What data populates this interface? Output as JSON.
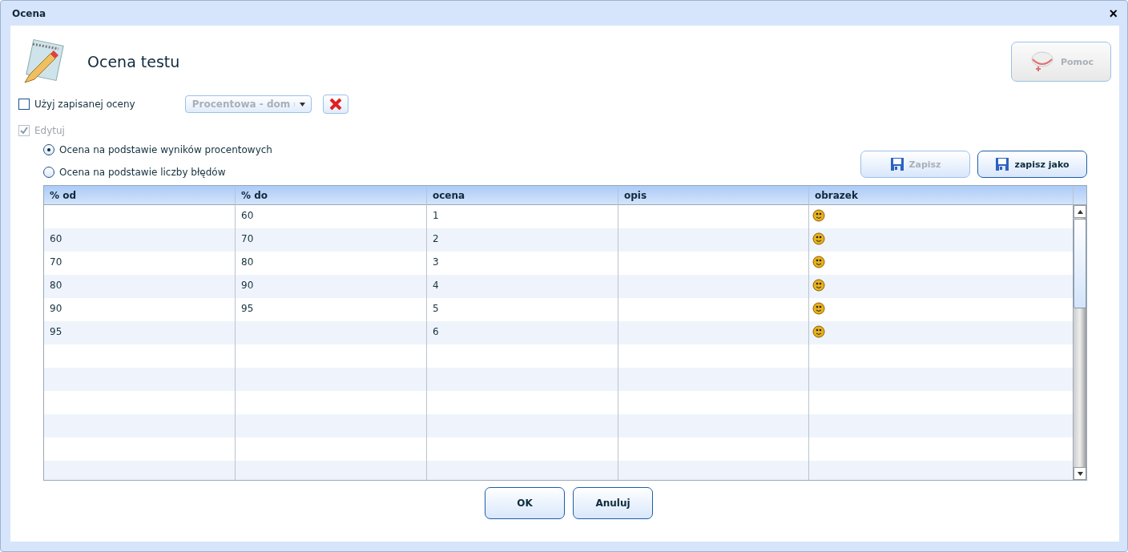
{
  "window": {
    "title": "Ocena",
    "close": "×"
  },
  "header": {
    "title": "Ocena testu",
    "help_button": {
      "label": "Pomoc",
      "disabled": true
    }
  },
  "use_saved": {
    "label": "Użyj zapisanej oceny",
    "checked": false
  },
  "saved_select": {
    "value": "Procentowa - dom",
    "disabled": true
  },
  "edit": {
    "label": "Edytuj",
    "checked": true,
    "disabled": true
  },
  "modes": [
    {
      "label": "Ocena na podstawie wyników procentowych",
      "selected": true
    },
    {
      "label": "Ocena na podstawie liczby błędów",
      "selected": false
    }
  ],
  "save_buttons": [
    {
      "label": "Zapisz",
      "disabled": true
    },
    {
      "label": "zapisz jako",
      "disabled": false
    }
  ],
  "table": {
    "columns": [
      "% od",
      "% do",
      "ocena",
      "opis",
      "obrazek"
    ],
    "rows": [
      {
        "cells": [
          "",
          "60",
          "1",
          ""
        ],
        "image": true
      },
      {
        "cells": [
          "60",
          "70",
          "2",
          ""
        ],
        "image": true
      },
      {
        "cells": [
          "70",
          "80",
          "3",
          ""
        ],
        "image": true
      },
      {
        "cells": [
          "80",
          "90",
          "4",
          ""
        ],
        "image": true
      },
      {
        "cells": [
          "90",
          "95",
          "5",
          ""
        ],
        "image": true
      },
      {
        "cells": [
          "95",
          "",
          "6",
          ""
        ],
        "image": true
      }
    ]
  },
  "buttons": [
    {
      "label": "OK"
    },
    {
      "label": "Anuluj"
    }
  ]
}
